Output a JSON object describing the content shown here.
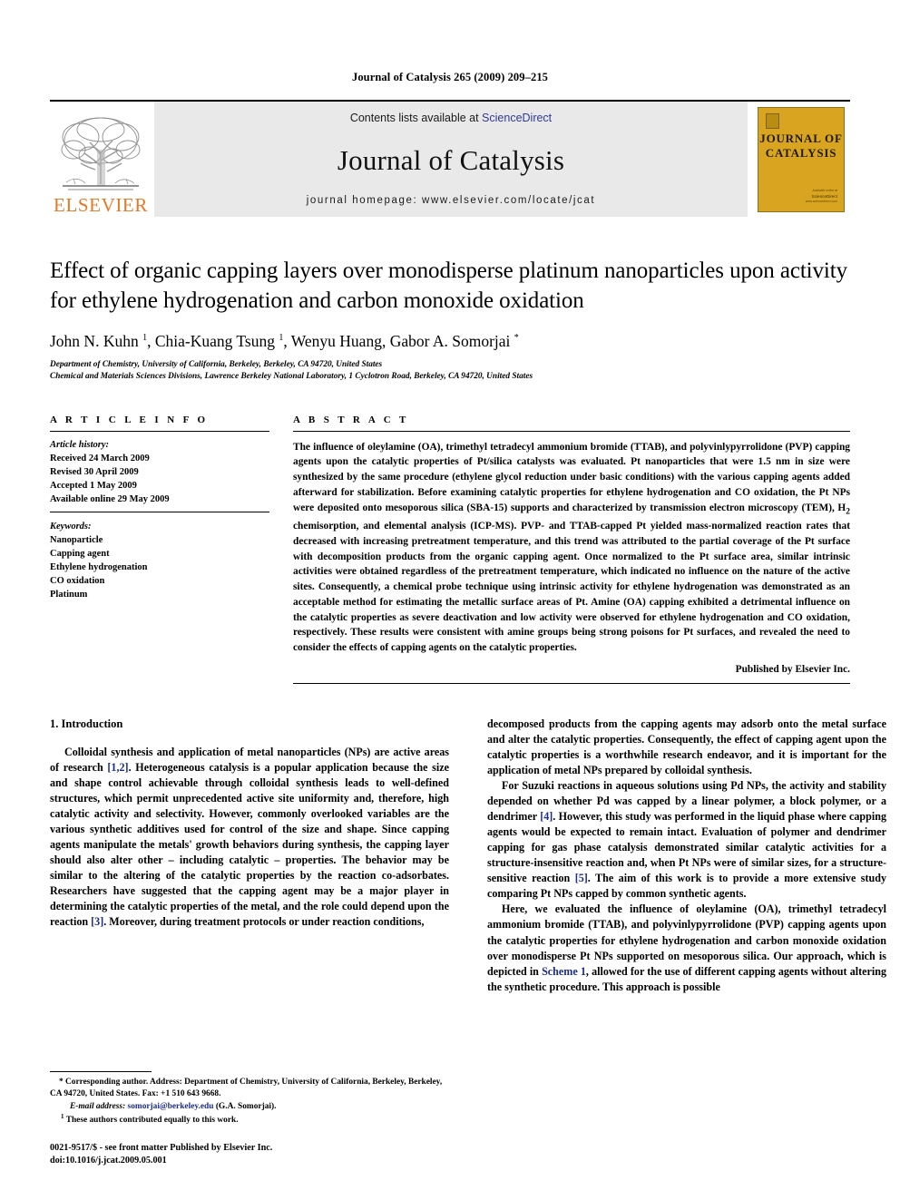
{
  "running_head": "Journal of Catalysis 265 (2009) 209–215",
  "masthead": {
    "elsevier_wordmark": "ELSEVIER",
    "contents_prefix": "Contents lists available at ",
    "sciencedirect": "ScienceDirect",
    "journal_title": "Journal of Catalysis",
    "homepage": "journal homepage: www.elsevier.com/locate/jcat",
    "cover_title_line1": "JOURNAL OF",
    "cover_title_line2": "CATALYSIS",
    "cover_sd_line1": "Available online at",
    "cover_sd_line2": "ScienceDirect",
    "cover_sd_line3": "www.sciencedirect.com",
    "accent_orange": "#E87722",
    "accent_blue": "#2F3A95",
    "cover_gold": "#D9A520",
    "band_grey": "#E9E9E9"
  },
  "article": {
    "title": "Effect of organic capping layers over monodisperse platinum nanoparticles upon activity for ethylene hydrogenation and carbon monoxide oxidation",
    "authors_html": "John N. Kuhn <sup>1</sup>, Chia-Kuang Tsung <sup>1</sup>, Wenyu Huang, Gabor A. Somorjai <sup>*</sup>",
    "affiliation_1": "Department of Chemistry, University of California, Berkeley, Berkeley, CA 94720, United States",
    "affiliation_2": "Chemical and Materials Sciences Divisions, Lawrence Berkeley National Laboratory, 1 Cyclotron Road, Berkeley, CA 94720, United States"
  },
  "article_info": {
    "kicker": "A R T I C L E    I N F O",
    "history_label": "Article history:",
    "history": [
      "Received 24 March 2009",
      "Revised 30 April 2009",
      "Accepted 1 May 2009",
      "Available online 29 May 2009"
    ],
    "keywords_label": "Keywords:",
    "keywords": [
      "Nanoparticle",
      "Capping agent",
      "Ethylene hydrogenation",
      "CO oxidation",
      "Platinum"
    ]
  },
  "abstract": {
    "kicker": "A B S T R A C T",
    "text": "The influence of oleylamine (OA), trimethyl tetradecyl ammonium bromide (TTAB), and polyvinlypyrrolidone (PVP) capping agents upon the catalytic properties of Pt/silica catalysts was evaluated. Pt nanoparticles that were 1.5 nm in size were synthesized by the same procedure (ethylene glycol reduction under basic conditions) with the various capping agents added afterward for stabilization. Before examining catalytic properties for ethylene hydrogenation and CO oxidation, the Pt NPs were deposited onto mesoporous silica (SBA-15) supports and characterized by transmission electron microscopy (TEM), H2 chemisorption, and elemental analysis (ICP-MS). PVP- and TTAB-capped Pt yielded mass-normalized reaction rates that decreased with increasing pretreatment temperature, and this trend was attributed to the partial coverage of the Pt surface with decomposition products from the organic capping agent. Once normalized to the Pt surface area, similar intrinsic activities were obtained regardless of the pretreatment temperature, which indicated no influence on the nature of the active sites. Consequently, a chemical probe technique using intrinsic activity for ethylene hydrogenation was demonstrated as an acceptable method for estimating the metallic surface areas of Pt. Amine (OA) capping exhibited a detrimental influence on the catalytic properties as severe deactivation and low activity were observed for ethylene hydrogenation and CO oxidation, respectively. These results were consistent with amine groups being strong poisons for Pt surfaces, and revealed the need to consider the effects of capping agents on the catalytic properties.",
    "publisher": "Published by Elsevier Inc."
  },
  "body": {
    "section_heading": "1. Introduction",
    "left_paragraph_1_a": "Colloidal synthesis and application of metal nanoparticles (NPs) are active areas of research ",
    "left_ref_12": "[1,2]",
    "left_paragraph_1_b": ". Heterogeneous catalysis is a popular application because the size and shape control achievable through colloidal synthesis leads to well-defined structures, which permit unprecedented active site uniformity and, therefore, high catalytic activity and selectivity. However, commonly overlooked variables are the various synthetic additives used for control of the size and shape. Since capping agents manipulate the metals' growth behaviors during synthesis, the capping layer should also alter other – including catalytic – properties. The behavior may be similar to the altering of the catalytic properties by the reaction co-adsorbates. Researchers have suggested that the capping agent may be a major player in determining the catalytic properties of the metal, and the role could depend upon the reaction ",
    "left_ref_3": "[3]",
    "left_paragraph_1_c": ". Moreover, during treatment protocols or under reaction conditions,",
    "right_paragraph_1": "decomposed products from the capping agents may adsorb onto the metal surface and alter the catalytic properties. Consequently, the effect of capping agent upon the catalytic properties is a worthwhile research endeavor, and it is important for the application of metal NPs prepared by colloidal synthesis.",
    "right_paragraph_2_a": "For Suzuki reactions in aqueous solutions using Pd NPs, the activity and stability depended on whether Pd was capped by a linear polymer, a block polymer, or a dendrimer ",
    "right_ref_4": "[4]",
    "right_paragraph_2_b": ". However, this study was performed in the liquid phase where capping agents would be expected to remain intact. Evaluation of polymer and dendrimer capping for gas phase catalysis demonstrated similar catalytic activities for a structure-insensitive reaction and, when Pt NPs were of similar sizes, for a structure-sensitive reaction ",
    "right_ref_5": "[5]",
    "right_paragraph_2_c": ". The aim of this work is to provide a more extensive study comparing Pt NPs capped by common synthetic agents.",
    "right_paragraph_3_a": "Here, we evaluated the influence of oleylamine (OA), trimethyl tetradecyl ammonium bromide (TTAB), and polyvinlypyrrolidone (PVP) capping agents upon the catalytic properties for ethylene hydrogenation and carbon monoxide oxidation over monodisperse Pt NPs supported on mesoporous silica. Our approach, which is depicted in ",
    "right_scheme_link": "Scheme 1",
    "right_paragraph_3_b": ", allowed for the use of different capping agents without altering the synthetic procedure. This approach is possible"
  },
  "footnotes": {
    "corresponding_a": "* Corresponding author. Address: Department of Chemistry, University of California, Berkeley, Berkeley, CA 94720, United States. Fax: +1 510 643 9668.",
    "email_label": "E-mail address:",
    "email": "somorjai@berkeley.edu",
    "email_suffix": " (G.A. Somorjai).",
    "equal_contrib": "These authors contributed equally to this work.",
    "equal_marker": "1",
    "imprint_line1": "0021-9517/$ - see front matter Published by Elsevier Inc.",
    "imprint_line2": "doi:10.1016/j.jcat.2009.05.001"
  }
}
